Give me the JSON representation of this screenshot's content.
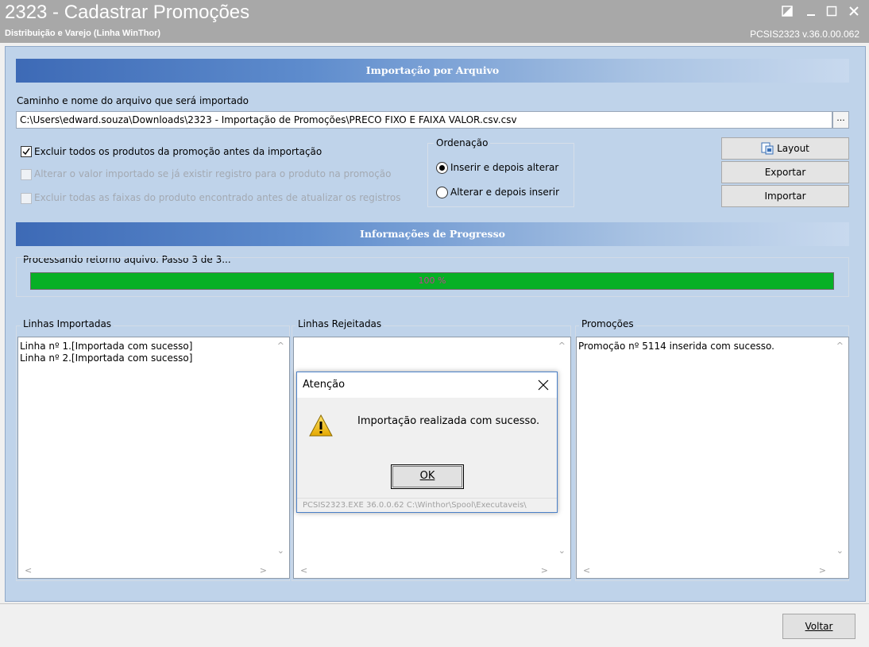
{
  "window": {
    "title": "2323 - Cadastrar Promoções",
    "subtitle": "Distribuição e Varejo (Linha WinThor)",
    "version": "PCSIS2323  v.36.0.00.062"
  },
  "import_section": {
    "header": "Importação por Arquivo",
    "path_label": "Caminho e nome do arquivo que será importado",
    "path_value": "C:\\Users\\edward.souza\\Downloads\\2323 - Importação de Promoções\\PRECO FIXO E FAIXA VALOR.csv.csv",
    "browse_label": "...",
    "options": [
      {
        "label": "Excluir todos os produtos da promoção antes da importação",
        "checked": true,
        "enabled": true
      },
      {
        "label": "Alterar o valor importado se já existir registro para o produto na promoção",
        "checked": false,
        "enabled": false
      },
      {
        "label": "Excluir todas as faixas do produto encontrado antes de atualizar os registros",
        "checked": false,
        "enabled": false
      }
    ],
    "ordering": {
      "title": "Ordenação",
      "options": [
        {
          "label": "Inserir e depois alterar",
          "selected": true
        },
        {
          "label": "Alterar e depois inserir",
          "selected": false
        }
      ]
    },
    "buttons": {
      "layout": "Layout",
      "exportar": "Exportar",
      "importar": "Importar"
    }
  },
  "progress_section": {
    "header": "Informações de Progresso",
    "status": "Processando retorno aquivo. Passo 3 de 3...",
    "percent_label": "100 %",
    "value": 1.0,
    "fill_color": "#07b025"
  },
  "lists": {
    "importadas": {
      "title": "Linhas Importadas",
      "lines": [
        "Linha nº 1.[Importada com sucesso]",
        "Linha nº 2.[Importada com sucesso]"
      ]
    },
    "rejeitadas": {
      "title": "Linhas Rejeitadas",
      "lines": []
    },
    "promocoes": {
      "title": "Promoções",
      "lines": [
        "Promoção nº 5114 inserida com sucesso."
      ]
    }
  },
  "dialog": {
    "title": "Atenção",
    "message": "Importação realizada com sucesso.",
    "ok_label": "OK",
    "footer": "PCSIS2323.EXE 36.0.0.62 C:\\Winthor\\Spool\\Executaveis\\",
    "icon": "warning-icon"
  },
  "footer": {
    "voltar_label": "Voltar"
  }
}
